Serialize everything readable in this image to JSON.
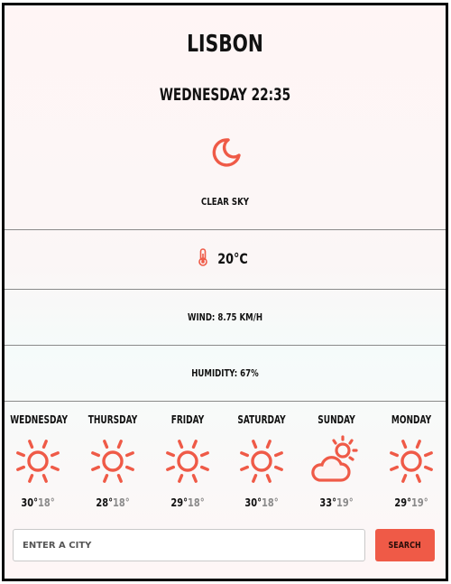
{
  "current": {
    "city": "LISBON",
    "datetime": "WEDNESDAY 22:35",
    "icon": "crescent-moon-icon",
    "condition": "CLEAR SKY",
    "temperature": "20°C",
    "wind": "WIND: 8.75 KM/H",
    "humidity": "HUMIDITY: 67%"
  },
  "forecast": [
    {
      "day": "WEDNESDAY",
      "icon": "sun-icon",
      "high": "30°",
      "low": "18°"
    },
    {
      "day": "THURSDAY",
      "icon": "sun-icon",
      "high": "28°",
      "low": "18°"
    },
    {
      "day": "FRIDAY",
      "icon": "sun-icon",
      "high": "29°",
      "low": "18°"
    },
    {
      "day": "SATURDAY",
      "icon": "sun-icon",
      "high": "30°",
      "low": "18°"
    },
    {
      "day": "SUNDAY",
      "icon": "partly-cloudy-icon",
      "high": "33°",
      "low": "19°"
    },
    {
      "day": "MONDAY",
      "icon": "sun-icon",
      "high": "29°",
      "low": "19°"
    }
  ],
  "search": {
    "placeholder": "ENTER A CITY",
    "button_label": "SEARCH"
  },
  "colors": {
    "accent": "#ef5a47",
    "muted_text": "#8a8a8a"
  }
}
